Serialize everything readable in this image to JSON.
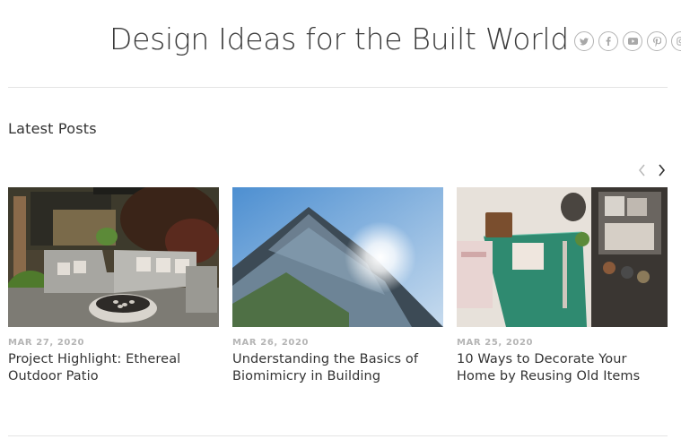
{
  "header": {
    "site_title": "Design Ideas for the Built World",
    "social_icons": [
      "twitter-icon",
      "facebook-icon",
      "youtube-icon",
      "pinterest-icon",
      "instagram-icon"
    ]
  },
  "latest_posts": {
    "heading": "Latest Posts",
    "posts": [
      {
        "date": "MAR 27, 2020",
        "title": "Project Highlight: Ethereal Outdoor Patio"
      },
      {
        "date": "MAR 26, 2020",
        "title": "Understanding the Basics of Biomimicry in Building"
      },
      {
        "date": "MAR 25, 2020",
        "title": "10 Ways to Decorate Your Home by Reusing Old Items"
      }
    ]
  },
  "colors": {
    "text": "#333333",
    "date": "#b5b5b5",
    "icon": "#a8a8a8",
    "rule": "#e4e4e4"
  }
}
